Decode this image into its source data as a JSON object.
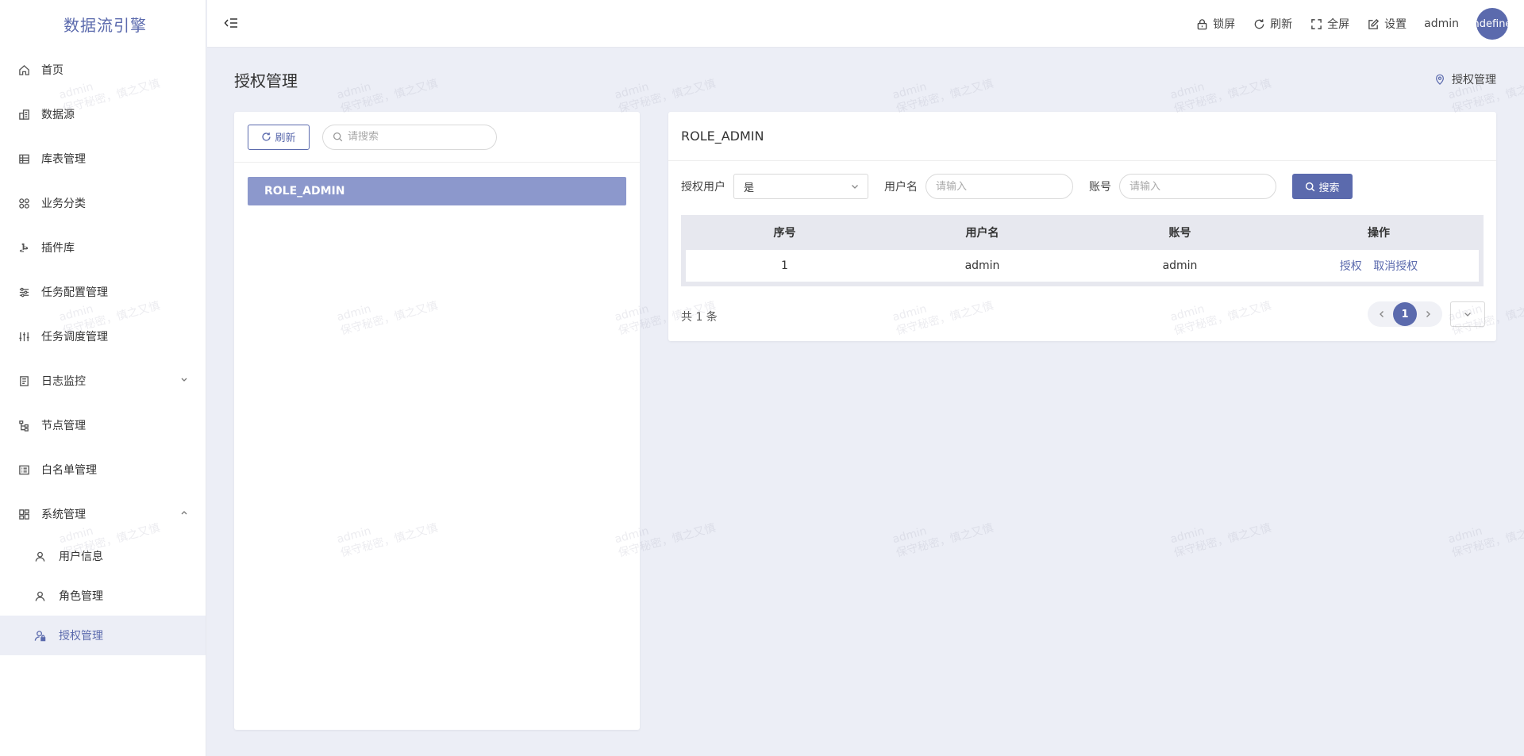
{
  "app": {
    "title": "数据流引擎"
  },
  "sidebar": {
    "items": [
      {
        "label": "首页"
      },
      {
        "label": "数据源"
      },
      {
        "label": "库表管理"
      },
      {
        "label": "业务分类"
      },
      {
        "label": "插件库"
      },
      {
        "label": "任务配置管理"
      },
      {
        "label": "任务调度管理"
      },
      {
        "label": "日志监控"
      },
      {
        "label": "节点管理"
      },
      {
        "label": "白名单管理"
      },
      {
        "label": "系统管理"
      }
    ],
    "sub_items": [
      {
        "label": "用户信息"
      },
      {
        "label": "角色管理"
      },
      {
        "label": "授权管理"
      }
    ]
  },
  "header": {
    "lock": "锁屏",
    "refresh": "刷新",
    "fullscreen": "全屏",
    "settings": "设置",
    "user": "admin",
    "avatar_text": "undefined"
  },
  "page": {
    "title": "授权管理",
    "breadcrumb": "授权管理"
  },
  "left_panel": {
    "refresh_label": "刷新",
    "search_placeholder": "请搜索",
    "roles": [
      "ROLE_ADMIN"
    ]
  },
  "right_panel": {
    "title": "ROLE_ADMIN",
    "filters": {
      "auth_user_label": "授权用户",
      "auth_user_value": "是",
      "username_label": "用户名",
      "username_placeholder": "请输入",
      "account_label": "账号",
      "account_placeholder": "请输入",
      "search_label": "搜索"
    },
    "table": {
      "headers": [
        "序号",
        "用户名",
        "账号",
        "操作"
      ],
      "rows": [
        {
          "index": "1",
          "username": "admin",
          "account": "admin",
          "op_grant": "授权",
          "op_revoke": "取消授权"
        }
      ]
    },
    "total": "共 1 条",
    "current_page": "1"
  },
  "watermark": {
    "line1": "admin",
    "line2": "保守秘密，慎之又慎"
  },
  "colors": {
    "accent": "#5b6aad",
    "role_selected": "#8c98cc",
    "background": "#eceef6"
  }
}
